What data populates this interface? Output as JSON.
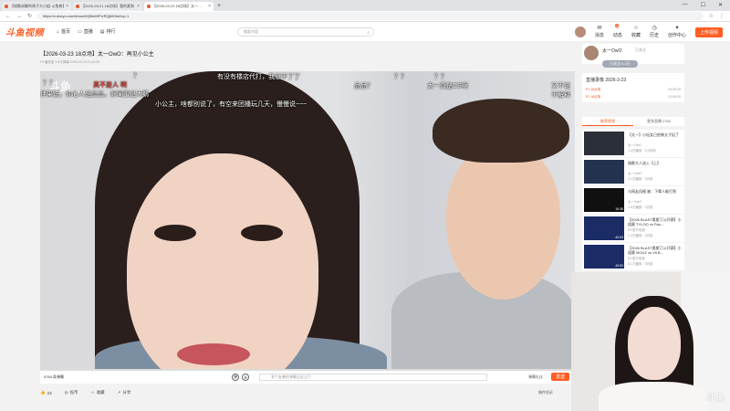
{
  "browser": {
    "tabs": [
      {
        "label": "【锐歌闲聊的周子大小姐·斗鱼修】",
        "active": false
      },
      {
        "label": "【2026-03-21 18点场】我的麦和【斗鱼…",
        "active": false
      },
      {
        "label": "【2026-03-23 18点场】太一…",
        "active": true
      }
    ],
    "new_tab": "+",
    "window_controls": [
      "—",
      "☐",
      "✕"
    ],
    "url": "https://v.douyu.com/show/0QBmMF1rRQjMOkd1xp-1"
  },
  "header": {
    "logo": "斗鱼视频",
    "nav": [
      "首页",
      "直播",
      "排行"
    ],
    "search_placeholder": "搜索内容",
    "right_items": [
      "消息",
      "动态",
      "收藏",
      "历史",
      "创作中心"
    ],
    "message_badge": "4",
    "live_button": "上传视频"
  },
  "video": {
    "title": "【2026-03-23 18点场】太一OwO：再见小公主",
    "meta": "DY播放量  5.5万弹幕  2026-03-23 21:40:03",
    "watermark": "斗鱼",
    "danmu": [
      {
        "text": "？",
        "color": "white"
      },
      {
        "text": "有没有楼店代打，我忍不了了",
        "color": "white"
      },
      {
        "text": "？？",
        "color": "white"
      },
      {
        "text": "？？",
        "color": "white"
      },
      {
        "text": "？？",
        "color": "white"
      },
      {
        "text": "真不是人  啊",
        "color": "red"
      },
      {
        "text": "品品？",
        "color": "white"
      },
      {
        "text": "太一真是CS啊",
        "color": "white"
      },
      {
        "text": "又不说",
        "color": "white"
      },
      {
        "text": "伴果说，你心人是晶晶，好闺蜜是大鹅",
        "color": "white"
      },
      {
        "text": "不解释",
        "color": "white"
      },
      {
        "text": "小公主，啥都别说了，有空来团播玩几天，慢慢说~~~",
        "color": "white"
      }
    ],
    "progress": 0.0
  },
  "controls": {
    "danmu_count": "5764 条弹幕",
    "danmu_placeholder": "发个友善的弹幕见证当下",
    "danmu_settings": "弹幕礼仪",
    "send": "发送"
  },
  "actions": {
    "like_count": "23",
    "coin": "投币",
    "collect": "收藏",
    "share": "分享",
    "report": "稿件投诉"
  },
  "sidebar": {
    "anchor_name": "太一OwO",
    "follow": "已关注",
    "fans_badge": "已关注 6.2万",
    "replay": {
      "title": "直播录像 2026-3-23",
      "sub": "P1 18点场",
      "sub2": "P2 18点场",
      "meta1": "02:05:05",
      "meta2": "01:59:05"
    },
    "tabs": [
      "推荐视频",
      "更多直播 2764"
    ],
    "videos": [
      {
        "title": "【太一】小仙女已经做太子妃了",
        "author": "太一OwO",
        "stats": "1.4万播放 · 3小时前",
        "duration": "",
        "thumb": "#2b2f38"
      },
      {
        "title": "瑞歌大人送入【上】",
        "author": "太一OwO",
        "stats": "2.1万播放 · 1天前",
        "duration": "",
        "thumb": "#23324f"
      },
      {
        "title": "与网友风格 被：下辈人能打到",
        "author": "太一OwO",
        "stats": "1.9万播放 · 1天前",
        "duration": "15:38",
        "thumb": "#101010"
      },
      {
        "title": "【2026 BLAST奥斯汀公开赛】小组赛 TYLOO vs Falc...",
        "author": "DY官方电竞",
        "stats": "1.3万播放 · 3天前",
        "duration": "40:03",
        "thumb": "#1a2b66"
      },
      {
        "title": "【2026 BLAST奥斯汀公开赛】小组赛 MOUZ vs Vit B...",
        "author": "DY官方电竞",
        "stats": "8.1万播放 · 3天前",
        "duration": "40:53",
        "thumb": "#1a2b66"
      }
    ]
  },
  "webcam": {
    "watermark": "斗鱼"
  }
}
